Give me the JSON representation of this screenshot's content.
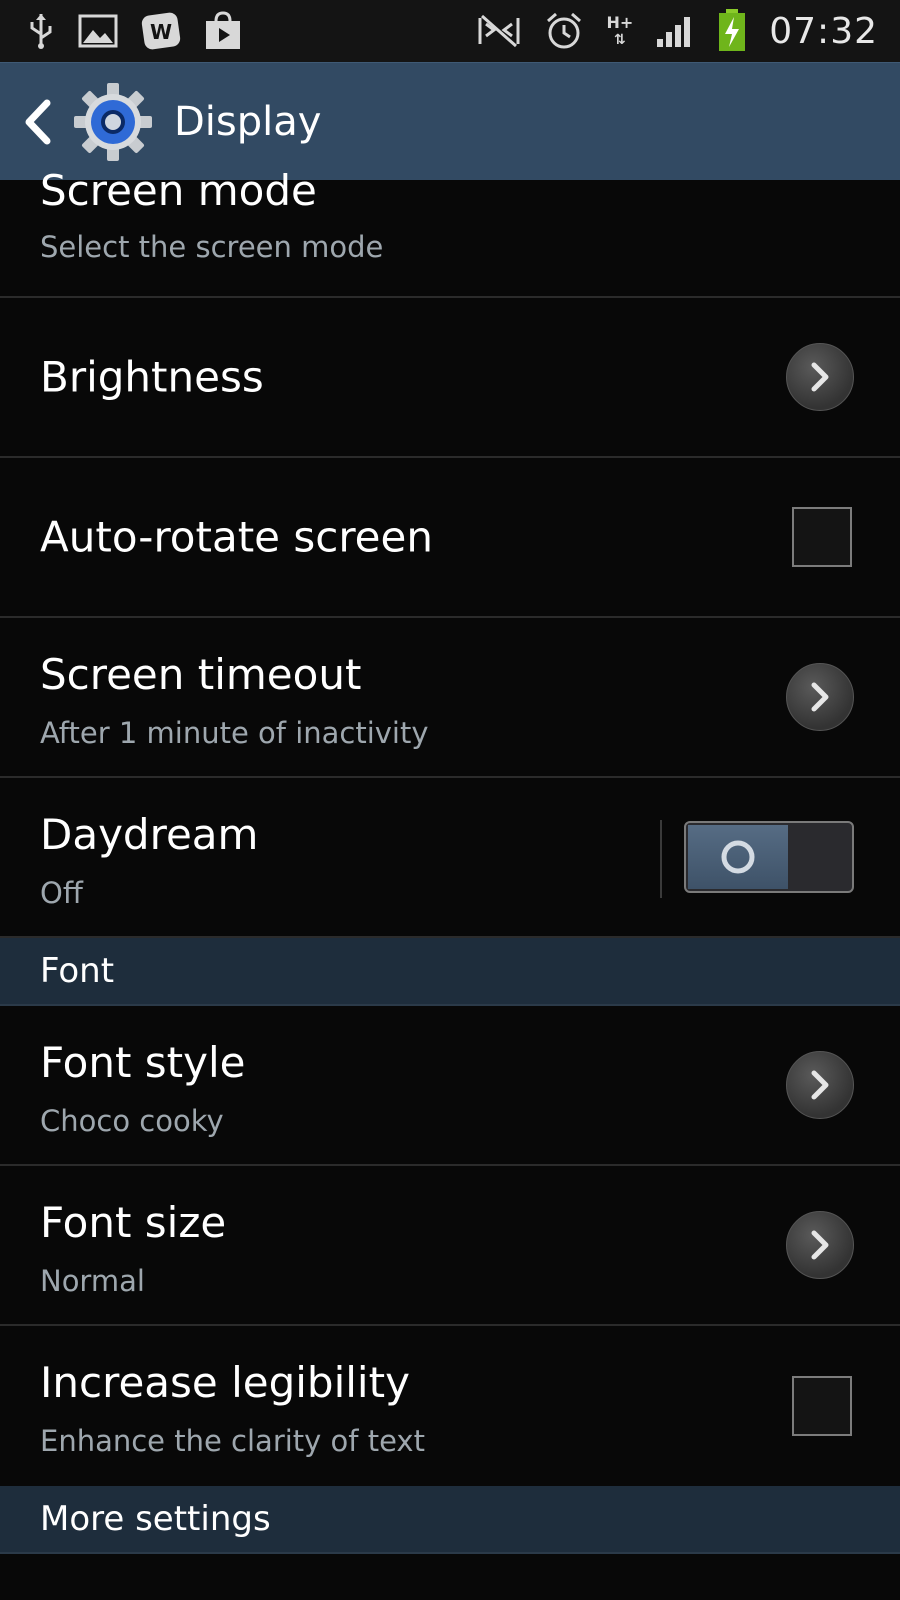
{
  "status_bar": {
    "time": "07:32",
    "network_label": "H+",
    "network_arrows": "⇅",
    "icons": [
      "usb-icon",
      "picture-icon",
      "w-app-icon",
      "play-store-icon",
      "nfc-mute-icon",
      "alarm-icon",
      "network-hplus-icon",
      "signal-icon",
      "battery-charging-icon"
    ]
  },
  "action_bar": {
    "title": "Display",
    "back_icon": "chevron-left-icon",
    "app_icon": "settings-gear-icon"
  },
  "rows": {
    "screen_mode": {
      "title": "Screen mode",
      "subtitle": "Select the screen mode"
    },
    "brightness": {
      "title": "Brightness"
    },
    "auto_rotate": {
      "title": "Auto-rotate screen",
      "checked": false
    },
    "screen_timeout": {
      "title": "Screen timeout",
      "subtitle": "After 1 minute of inactivity"
    },
    "daydream": {
      "title": "Daydream",
      "subtitle": "Off",
      "toggle": "off"
    },
    "font_style": {
      "title": "Font style",
      "subtitle": "Choco cooky"
    },
    "font_size": {
      "title": "Font size",
      "subtitle": "Normal"
    },
    "increase_legibility": {
      "title": "Increase legibility",
      "subtitle": "Enhance the clarity of text",
      "checked": false
    }
  },
  "sections": {
    "font": "Font",
    "more_settings": "More settings"
  },
  "colors": {
    "action_bar": "#324a63",
    "section_header": "#1e2d3c",
    "background": "#080808",
    "subtitle_text": "#9ea7ae"
  }
}
